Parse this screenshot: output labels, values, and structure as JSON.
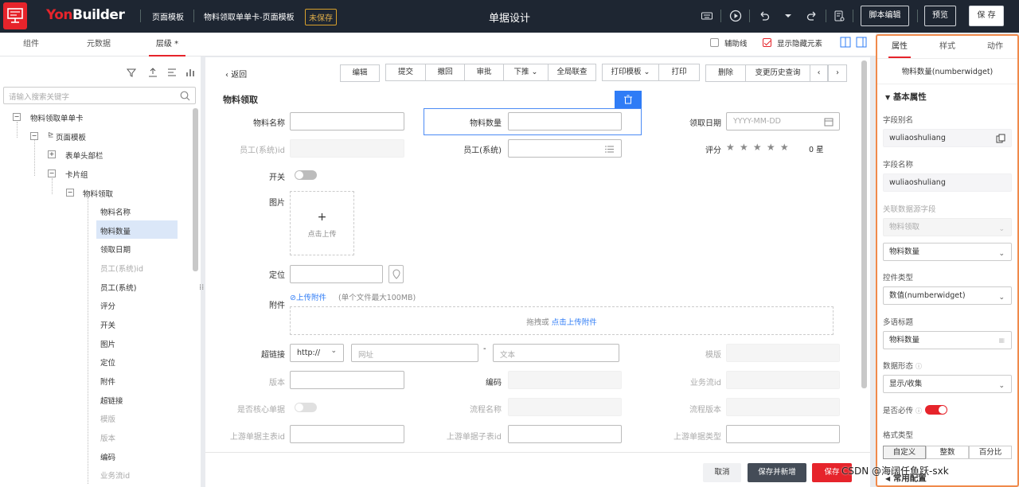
{
  "header": {
    "brand_prefix": "Yon",
    "brand_suffix": "Builder",
    "crumb_template": "页面模板",
    "crumb_page": "物料领取单单卡-页面模板",
    "unsaved": "未保存",
    "center_title": "单据设计",
    "script_edit": "脚本编辑",
    "preview": "预览",
    "save": "保 存"
  },
  "subbar": {
    "tabs": [
      "组件",
      "元数据",
      "层级 *"
    ],
    "aux_lines": "辅助线",
    "show_hidden": "显示隐藏元素"
  },
  "left": {
    "search_placeholder": "请输入搜索关键字",
    "tree": [
      {
        "label": "物料领取单单卡",
        "dim": false
      },
      {
        "label": "页面模板",
        "dim": false
      },
      {
        "label": "表单头部栏",
        "dim": false
      },
      {
        "label": "卡片组",
        "dim": false
      },
      {
        "label": "物料领取",
        "dim": false
      },
      {
        "label": "物料名称",
        "dim": false
      },
      {
        "label": "物料数量",
        "dim": false
      },
      {
        "label": "领取日期",
        "dim": false
      },
      {
        "label": "员工(系统)id",
        "dim": true
      },
      {
        "label": "员工(系统)",
        "dim": false
      },
      {
        "label": "评分",
        "dim": false
      },
      {
        "label": "开关",
        "dim": false
      },
      {
        "label": "图片",
        "dim": false
      },
      {
        "label": "定位",
        "dim": false
      },
      {
        "label": "附件",
        "dim": false
      },
      {
        "label": "超链接",
        "dim": false
      },
      {
        "label": "模版",
        "dim": true
      },
      {
        "label": "版本",
        "dim": true
      },
      {
        "label": "编码",
        "dim": false
      },
      {
        "label": "业务流id",
        "dim": true
      }
    ]
  },
  "canvas": {
    "back": "返回",
    "toolbar": {
      "edit": "编辑",
      "submit": "提交",
      "withdraw": "撤回",
      "approve": "审批",
      "push_down": "下推",
      "global_query": "全局联查",
      "print_template": "打印模板",
      "print": "打印",
      "delete": "删除",
      "history": "变更历史查询"
    },
    "section_title": "物料领取",
    "fields": {
      "material_name": "物料名称",
      "material_qty": "物料数量",
      "pick_date": "领取日期",
      "date_placeholder": "YYYY-MM-DD",
      "employee_id": "员工(系统)id",
      "employee": "员工(系统)",
      "rating": "评分",
      "rating_value": "0 星",
      "switch": "开关",
      "image": "图片",
      "upload_click": "点击上传",
      "location": "定位",
      "attachment": "附件",
      "upload_attachment": "上传附件",
      "attachment_limit": "(单个文件最大100MB)",
      "drag_prefix": "拖拽或",
      "drag_link": "点击上传附件",
      "hyperlink": "超链接",
      "protocol": "http://",
      "url_placeholder": "网址",
      "dash": "-",
      "text_placeholder": "文本",
      "template": "模版",
      "version": "版本",
      "code": "编码",
      "biz_flow_id": "业务流id",
      "is_core": "是否核心单据",
      "flow_name": "流程名称",
      "flow_version": "流程版本",
      "up_main_id": "上游单据主表id",
      "up_sub_id": "上游单据子表id",
      "up_type": "上游单据类型"
    },
    "footer": {
      "cancel": "取消",
      "save_new": "保存并新增",
      "save": "保存"
    }
  },
  "right": {
    "tabs": [
      "属性",
      "样式",
      "动作"
    ],
    "component_title": "物料数量(numberwidget)",
    "section": "基本属性",
    "field_alias_label": "字段别名",
    "field_alias": "wuliaoshuliang",
    "field_name_label": "字段名称",
    "field_name": "wuliaoshuliang",
    "ds_label": "关联数据源字段",
    "ds_value1": "物料领取",
    "ds_value2": "物料数量",
    "ctrl_type_label": "控件类型",
    "ctrl_type": "数值(numberwidget)",
    "i18n_label": "多语标题",
    "i18n_value": "物料数量",
    "data_form_label": "数据形态",
    "data_form": "显示/收集",
    "required_label": "是否必传",
    "format_label": "格式类型",
    "format_options": [
      "自定义",
      "整数",
      "百分比"
    ],
    "bottom_cut": "常用配置"
  },
  "watermark": "CSDN @海阔任鱼跃-sxk",
  "colors": {
    "brand_red": "#e6242b",
    "topbar": "#1e2632",
    "highlight": "#f08a4b",
    "select_blue": "#2f7cf6"
  }
}
